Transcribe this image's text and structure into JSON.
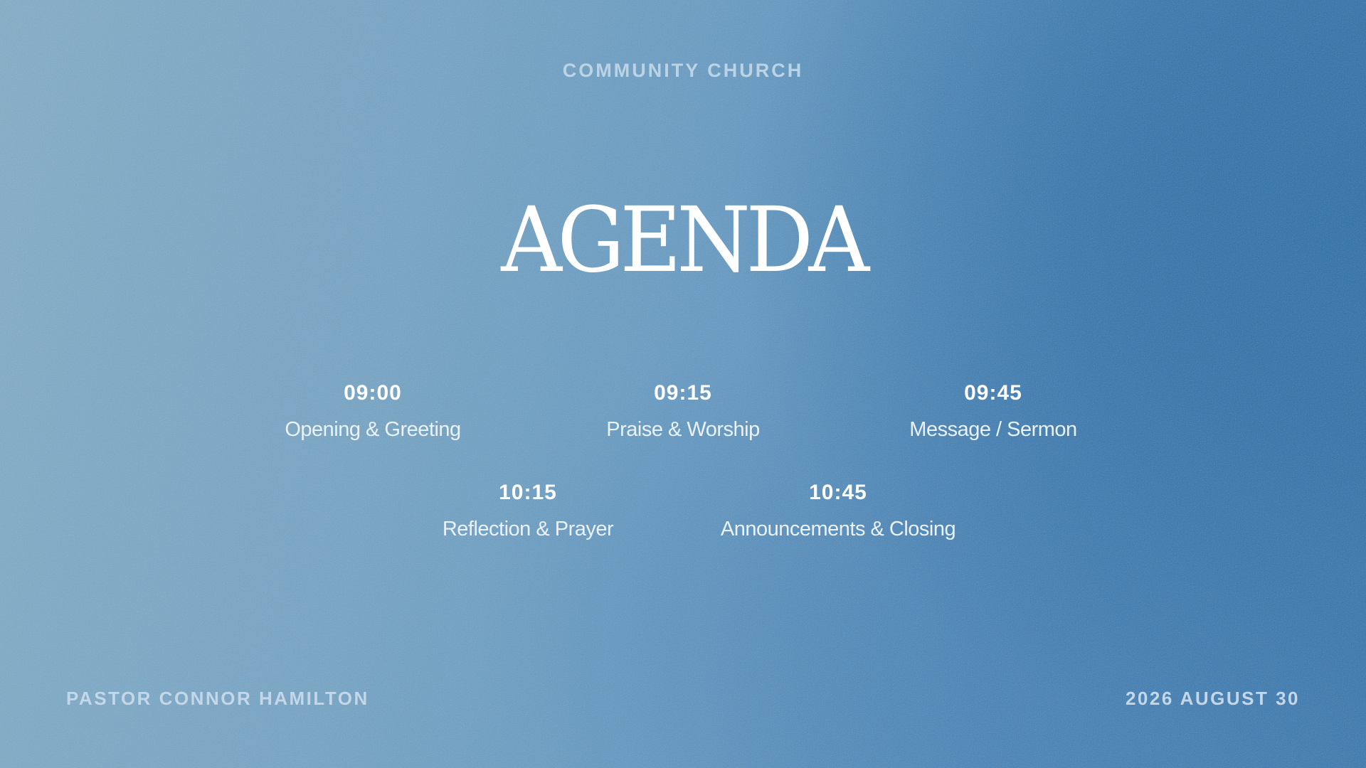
{
  "slide": {
    "organization": "COMMUNITY CHURCH",
    "title": "AGENDA",
    "agenda": [
      {
        "time": "09:00",
        "label": "Opening & Greeting"
      },
      {
        "time": "09:15",
        "label": "Praise & Worship"
      },
      {
        "time": "09:45",
        "label": "Message / Sermon"
      },
      {
        "time": "10:15",
        "label": "Reflection & Prayer"
      },
      {
        "time": "10:45",
        "label": "Announcements & Closing"
      }
    ],
    "footer": {
      "presenter": "PASTOR CONNOR HAMILTON",
      "date": "2026 AUGUST 30"
    }
  },
  "colors": {
    "background_light": "#7eacc9",
    "background_deep": "#236aa7",
    "text_primary": "#ffffff",
    "text_muted": "#bcd3e6"
  }
}
